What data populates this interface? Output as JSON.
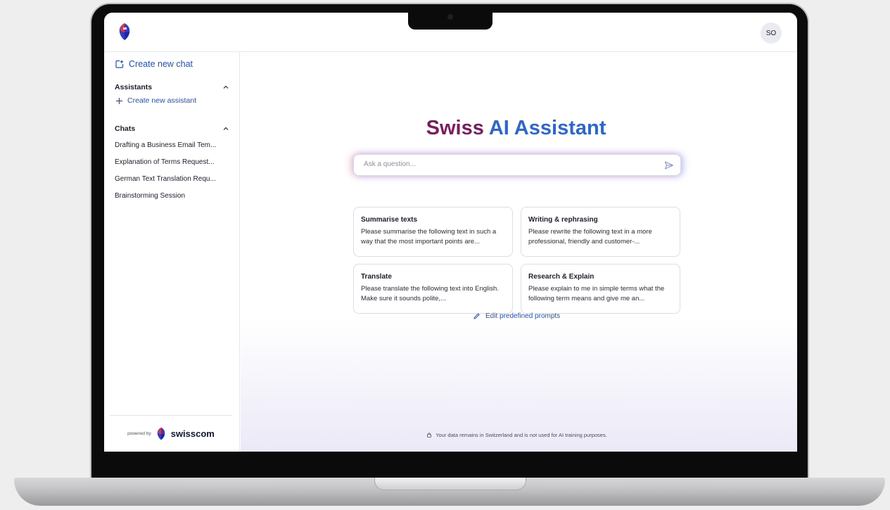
{
  "topbar": {
    "avatar_initials": "SO"
  },
  "sidebar": {
    "new_chat_label": "Create new chat",
    "assistants_title": "Assistants",
    "create_assistant_label": "Create new assistant",
    "chats_title": "Chats",
    "chats": [
      "Drafting a Business Email Tem...",
      "Explanation of Terms Request...",
      "German Text Translation Requ...",
      "Brainstorming Session"
    ],
    "powered_by": "powered by",
    "brand": "swisscom"
  },
  "main": {
    "title_part1": "Swiss",
    "title_part2": "AI Assistant",
    "search_placeholder": "Ask a question...",
    "cards": [
      {
        "title": "Summarise texts",
        "text": "Please summarise the following text in such a way that the most important points are..."
      },
      {
        "title": "Writing & rephrasing",
        "text": "Please rewrite the following text in a more professional, friendly and customer-..."
      },
      {
        "title": "Translate",
        "text": "Please translate the following text into English. Make sure it sounds polite,..."
      },
      {
        "title": "Research & Explain",
        "text": "Please explain to me in simple terms what the following term means and give me an..."
      }
    ],
    "edit_prompts_label": "Edit predefined prompts",
    "privacy_note": "Your data remains in Switzerland and is not used for AI training purposes."
  },
  "colors": {
    "accent_blue": "#1d4fd8",
    "title_purple": "#7a1c5e",
    "title_blue": "#2b67d4"
  },
  "icons": {
    "logo": "swisscom-logo",
    "new_chat": "new-chat-icon",
    "plus": "plus-icon",
    "chevron": "chevron-up-icon",
    "send": "send-icon",
    "edit": "pencil-icon",
    "lock": "lock-icon"
  }
}
